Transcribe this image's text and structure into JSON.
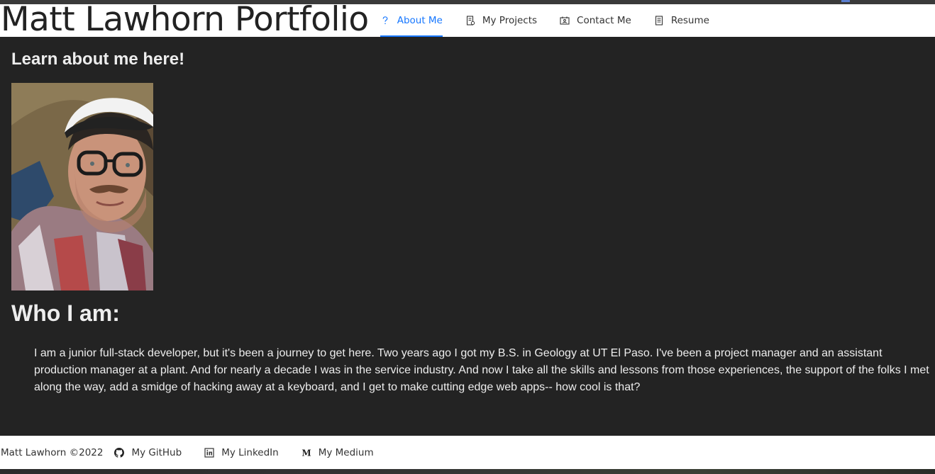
{
  "site": {
    "title": "Matt Lawhorn Portfolio"
  },
  "nav": {
    "items": [
      {
        "label": "About Me",
        "icon": "question-icon",
        "active": true
      },
      {
        "label": "My Projects",
        "icon": "document-icon",
        "active": false
      },
      {
        "label": "Contact Me",
        "icon": "contact-card-icon",
        "active": false
      },
      {
        "label": "Resume",
        "icon": "resume-icon",
        "active": false
      }
    ]
  },
  "about": {
    "intro_heading": "Learn about me here!",
    "portrait_icon": "portrait-photo",
    "who_heading": "Who I am:",
    "bio": "I am a junior full-stack developer, but it's been a journey to get here. Two years ago I got my B.S. in Geology at UT El Paso. I've been a project manager and an assistant production manager at a plant. And for nearly a decade I was in the service industry. And now I take all the skills and lessons from those experiences, the support of the folks I met along the way, add a smidge of hacking away at a keyboard, and I get to make cutting edge web apps-- how cool is that?"
  },
  "footer": {
    "copyright": "Matt Lawhorn ©2022",
    "links": [
      {
        "label": "My GitHub",
        "icon": "github-icon"
      },
      {
        "label": "My LinkedIn",
        "icon": "linkedin-icon"
      },
      {
        "label": "My Medium",
        "icon": "medium-icon"
      }
    ]
  },
  "colors": {
    "accent": "#1677ff",
    "background": "#232323",
    "header_background": "#ffffff",
    "text_light": "#ededed"
  }
}
